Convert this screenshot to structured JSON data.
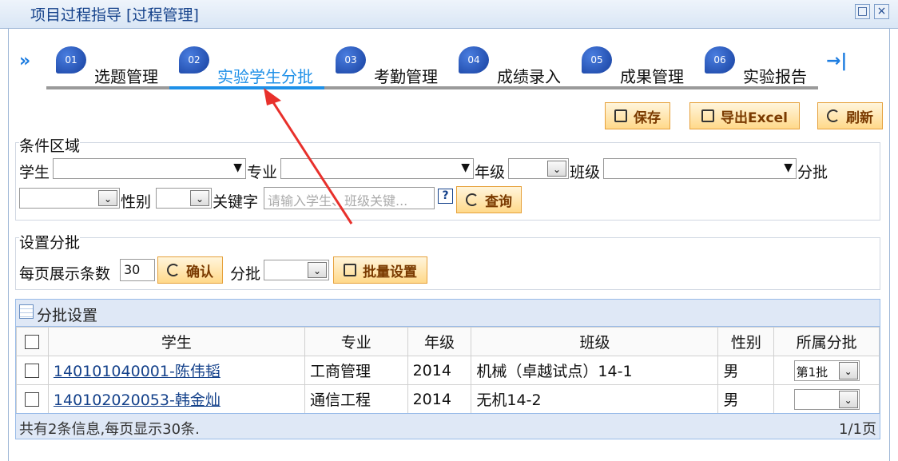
{
  "window": {
    "title": "项目过程指导 [过程管理]"
  },
  "steps": [
    {
      "num": "01",
      "label": "选题管理"
    },
    {
      "num": "02",
      "label": "实验学生分批"
    },
    {
      "num": "03",
      "label": "考勤管理"
    },
    {
      "num": "04",
      "label": "成绩录入"
    },
    {
      "num": "05",
      "label": "成果管理"
    },
    {
      "num": "06",
      "label": "实验报告"
    }
  ],
  "toolbar": {
    "save": "保存",
    "export": "导出Excel",
    "refresh": "刷新"
  },
  "conditions": {
    "legend": "条件区域",
    "student": "学生",
    "major": "专业",
    "grade": "年级",
    "class": "班级",
    "batch": "分批",
    "gender": "性别",
    "keyword": "关键字",
    "keyword_placeholder": "请输入学生、班级关键...",
    "query": "查询"
  },
  "settings": {
    "legend": "设置分批",
    "page_size_label": "每页展示条数",
    "page_size": "30",
    "confirm": "确认",
    "batch": "分批",
    "bulk_set": "批量设置"
  },
  "grid": {
    "title": "分批设置",
    "columns": [
      "学生",
      "专业",
      "年级",
      "班级",
      "性别",
      "所属分批"
    ],
    "rows": [
      {
        "student": "140101040001-陈伟韬",
        "major": "工商管理",
        "grade": "2014",
        "class": "机械（卓越试点）14-1",
        "gender": "男",
        "batch": "第1批"
      },
      {
        "student": "140102020053-韩金灿",
        "major": "通信工程",
        "grade": "2014",
        "class": "无机14-2",
        "gender": "男",
        "batch": ""
      }
    ],
    "footer_info": "共有2条信息,每页显示30条.",
    "pager": "1/1页"
  }
}
